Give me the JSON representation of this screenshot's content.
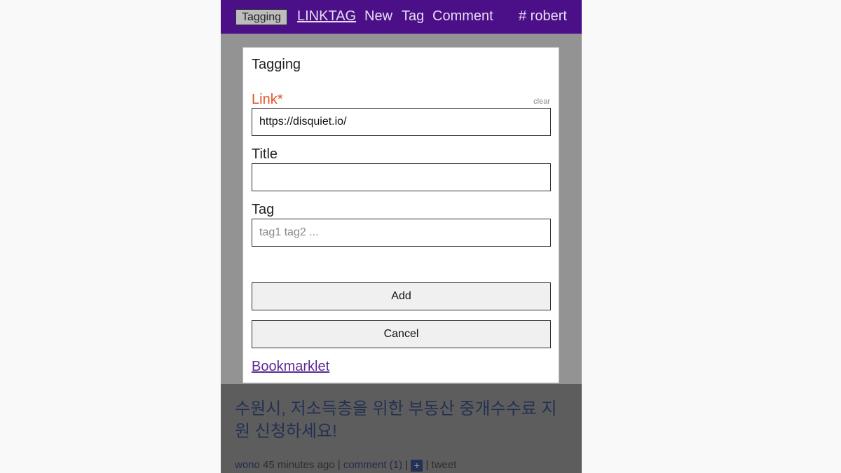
{
  "header": {
    "badge": "Tagging",
    "brand": "LINKTAG",
    "nav_new": "New",
    "nav_tag": "Tag",
    "nav_comment": "Comment",
    "user": "# robert"
  },
  "modal": {
    "title": "Tagging",
    "link_label": "Link*",
    "clear_label": "clear",
    "link_value": "https://disquiet.io/",
    "title_label": "Title",
    "title_value": "",
    "tag_label": "Tag",
    "tag_placeholder": "tag1 tag2 ...",
    "add_label": "Add",
    "cancel_label": "Cancel",
    "bookmarklet_label": "Bookmarklet"
  },
  "feed": {
    "headline": "수원시, 저소득층을 위한 부동산 중개수수료 지원 신청하세요!",
    "author": "wono",
    "time": "45 minutes ago",
    "sep1": "|",
    "comment": "comment (1)",
    "sep2": "|",
    "plus": "+",
    "sep3": "|",
    "tweet": "tweet"
  },
  "colors": {
    "header_bg": "#4b0f87",
    "required_label": "#e2532a",
    "link": "#5b2a94",
    "headline": "#1f3a7a"
  }
}
